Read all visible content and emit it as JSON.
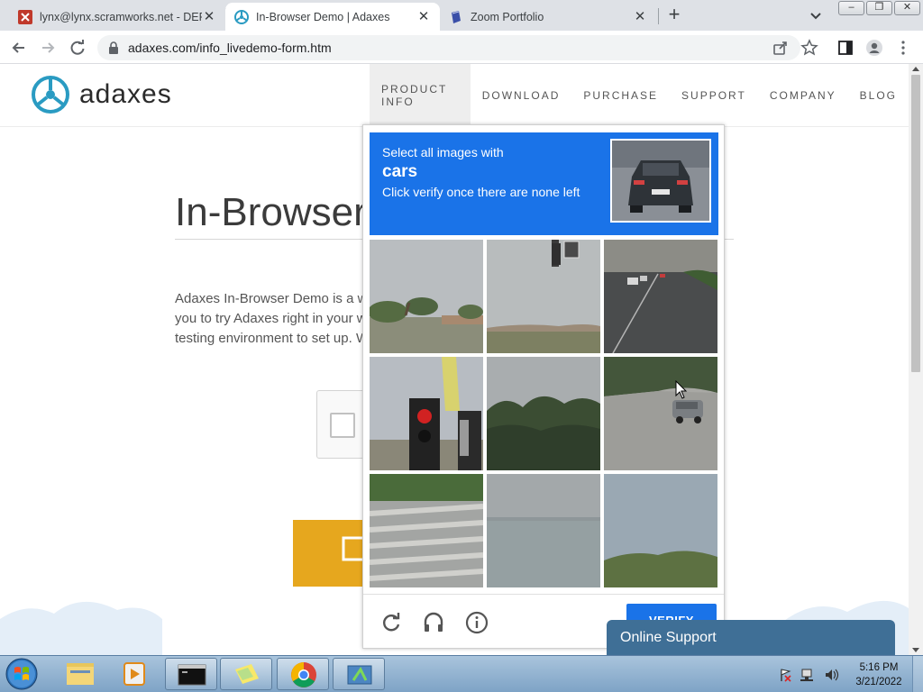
{
  "browser": {
    "tabs": [
      {
        "title": "lynx@lynx.scramworks.net - DEPI",
        "active": false
      },
      {
        "title": "In-Browser Demo | Adaxes",
        "active": true
      },
      {
        "title": "Zoom Portfolio",
        "active": false
      }
    ],
    "close_glyph": "✕",
    "new_tab_glyph": "+",
    "window_buttons": [
      "–",
      "❐",
      "✕"
    ],
    "url": "adaxes.com/info_livedemo-form.htm"
  },
  "site": {
    "logo_text": "adaxes",
    "nav": [
      "PRODUCT INFO",
      "DOWNLOAD",
      "PURCHASE",
      "SUPPORT",
      "COMPANY",
      "BLOG"
    ],
    "nav_active": "PRODUCT INFO",
    "heading": "In-Browser",
    "intro_lines": [
      "Adaxes In-Browser Demo is a wel",
      "you to try Adaxes right in your we",
      "testing environment to set up. W"
    ]
  },
  "captcha": {
    "line1": "Select all images with",
    "target": "cars",
    "line3": "Click verify once there are none left",
    "tiles": [
      "palm-trees",
      "traffic-light-sky",
      "highway-cars",
      "traffic-light-red",
      "trees-sky",
      "road-with-car",
      "crosswalk",
      "sky-field",
      "grass-hill"
    ],
    "verify_label": "VERIFY",
    "accent": "#1a73e8"
  },
  "support": {
    "label": "Online Support"
  },
  "taskbar": {
    "time": "5:16 PM",
    "date": "3/21/2022"
  }
}
